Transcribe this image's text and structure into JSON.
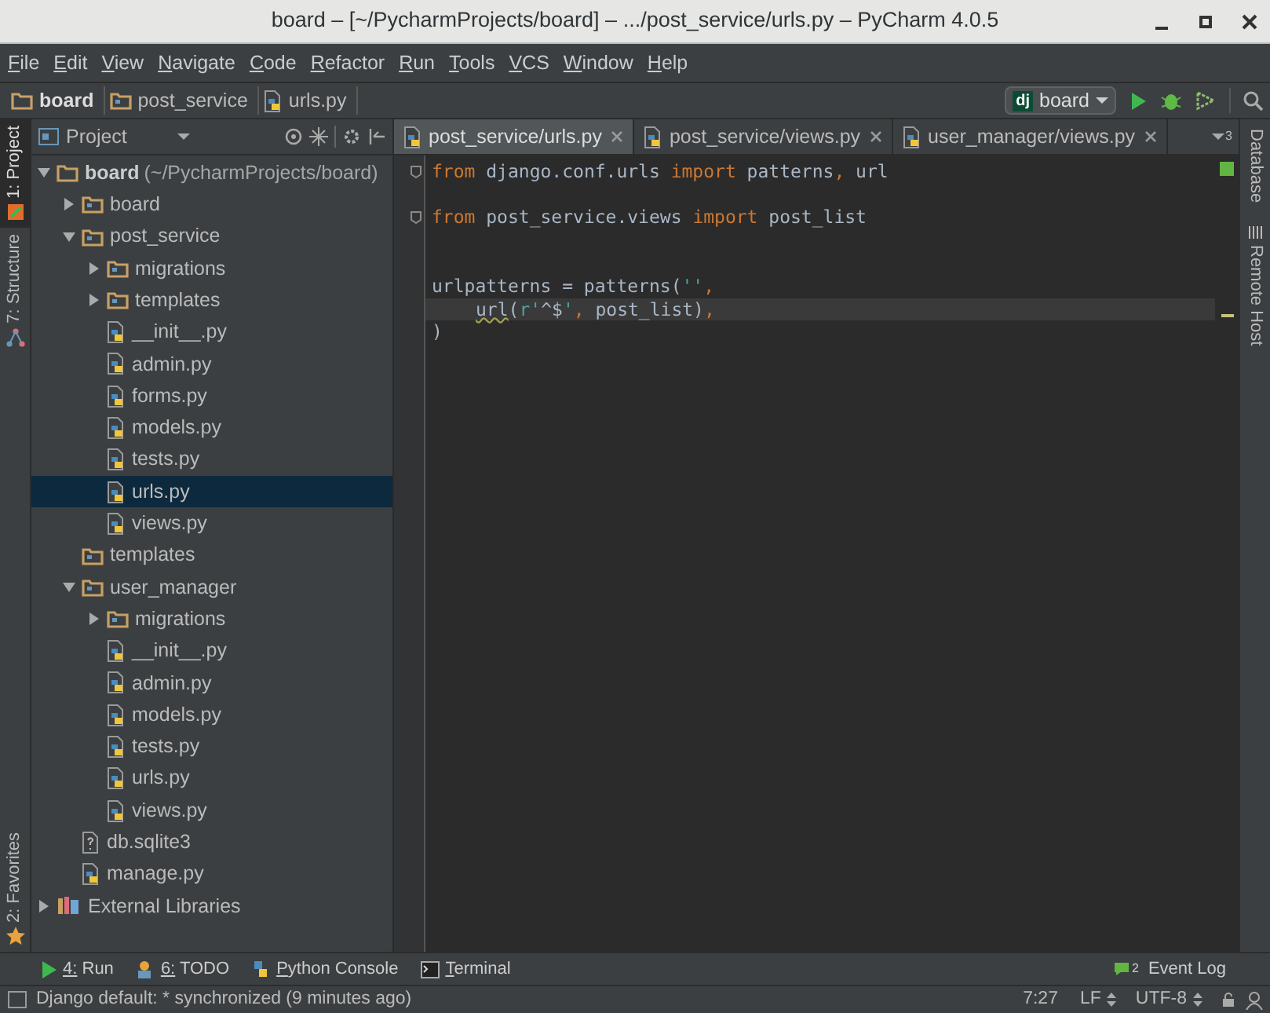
{
  "window": {
    "title": "board – [~/PycharmProjects/board] – .../post_service/urls.py – PyCharm 4.0.5"
  },
  "menu": [
    "File",
    "Edit",
    "View",
    "Navigate",
    "Code",
    "Refactor",
    "Run",
    "Tools",
    "VCS",
    "Window",
    "Help"
  ],
  "breadcrumbs": [
    {
      "label": "board",
      "kind": "folder"
    },
    {
      "label": "post_service",
      "kind": "module"
    },
    {
      "label": "urls.py",
      "kind": "python"
    }
  ],
  "run_config": {
    "badge": "dj",
    "label": "board"
  },
  "left_tools": [
    {
      "label": "1: Project",
      "selected": true,
      "kind": "project"
    },
    {
      "label": "7: Structure",
      "selected": false,
      "kind": "structure"
    },
    {
      "label": "2: Favorites",
      "selected": false,
      "kind": "favorites"
    }
  ],
  "right_tools": [
    {
      "label": "Database",
      "kind": "database"
    },
    {
      "label": "Remote Host",
      "kind": "server"
    }
  ],
  "project_panel": {
    "title": "Project",
    "tree": [
      {
        "label": "board",
        "suffix": "(~/PycharmProjects/board)",
        "kind": "folder",
        "expanded": true,
        "selected": false,
        "children": [
          {
            "label": "board",
            "kind": "module",
            "expanded": false,
            "selected": false
          },
          {
            "label": "post_service",
            "kind": "module",
            "expanded": true,
            "selected": false,
            "children": [
              {
                "label": "migrations",
                "kind": "module",
                "expanded": false,
                "selected": false
              },
              {
                "label": "templates",
                "kind": "module",
                "expanded": false,
                "selected": false
              },
              {
                "label": "__init__.py",
                "kind": "python",
                "selected": false
              },
              {
                "label": "admin.py",
                "kind": "python",
                "selected": false
              },
              {
                "label": "forms.py",
                "kind": "python",
                "selected": false
              },
              {
                "label": "models.py",
                "kind": "python",
                "selected": false
              },
              {
                "label": "tests.py",
                "kind": "python",
                "selected": false
              },
              {
                "label": "urls.py",
                "kind": "python",
                "selected": true
              },
              {
                "label": "views.py",
                "kind": "python",
                "selected": false
              }
            ]
          },
          {
            "label": "templates",
            "kind": "module",
            "selected": false
          },
          {
            "label": "user_manager",
            "kind": "module",
            "expanded": true,
            "selected": false,
            "children": [
              {
                "label": "migrations",
                "kind": "module",
                "expanded": false,
                "selected": false
              },
              {
                "label": "__init__.py",
                "kind": "python",
                "selected": false
              },
              {
                "label": "admin.py",
                "kind": "python",
                "selected": false
              },
              {
                "label": "models.py",
                "kind": "python",
                "selected": false
              },
              {
                "label": "tests.py",
                "kind": "python",
                "selected": false
              },
              {
                "label": "urls.py",
                "kind": "python",
                "selected": false
              },
              {
                "label": "views.py",
                "kind": "python",
                "selected": false
              }
            ]
          },
          {
            "label": "db.sqlite3",
            "kind": "unknown",
            "selected": false
          },
          {
            "label": "manage.py",
            "kind": "python",
            "selected": false
          }
        ]
      },
      {
        "label": "External Libraries",
        "kind": "library",
        "expanded": false,
        "selected": false
      }
    ]
  },
  "tabs": [
    {
      "label": "post_service/urls.py",
      "selected": true
    },
    {
      "label": "post_service/views.py",
      "selected": false
    },
    {
      "label": "user_manager/views.py",
      "selected": false
    }
  ],
  "tab_overflow": "3",
  "editor": {
    "lines": [
      {
        "kind": "code",
        "fold": true,
        "current": false,
        "tokens": [
          {
            "kind": "kw",
            "text": "from"
          },
          {
            "kind": "plain",
            "text": " django.conf.urls "
          },
          {
            "kind": "kw",
            "text": "import"
          },
          {
            "kind": "plain",
            "text": " patterns"
          },
          {
            "kind": "kw",
            "text": ","
          },
          {
            "kind": "plain",
            "text": " url"
          }
        ]
      },
      {
        "kind": "blank",
        "fold": false,
        "current": false
      },
      {
        "kind": "code",
        "fold": true,
        "current": false,
        "tokens": [
          {
            "kind": "kw",
            "text": "from"
          },
          {
            "kind": "plain",
            "text": " post_service.views "
          },
          {
            "kind": "kw",
            "text": "import"
          },
          {
            "kind": "plain",
            "text": " post_list"
          }
        ]
      },
      {
        "kind": "blank",
        "fold": false,
        "current": false
      },
      {
        "kind": "blank",
        "fold": false,
        "current": false
      },
      {
        "kind": "code",
        "fold": false,
        "current": false,
        "tokens": [
          {
            "kind": "plain",
            "text": "urlpatterns = patterns("
          },
          {
            "kind": "str",
            "text": "''"
          },
          {
            "kind": "kw",
            "text": ","
          }
        ]
      },
      {
        "kind": "indented",
        "fold": false,
        "current": true,
        "tokens": [
          {
            "kind": "warn",
            "text": "url"
          },
          {
            "kind": "plain",
            "text": "("
          },
          {
            "kind": "str",
            "text": "r'"
          },
          {
            "kind": "plain",
            "text": "^$"
          },
          {
            "kind": "str",
            "text": "'"
          },
          {
            "kind": "kw",
            "text": ","
          },
          {
            "kind": "plain",
            "text": " post_list)"
          },
          {
            "kind": "kw",
            "text": ","
          }
        ]
      },
      {
        "kind": "code",
        "fold": false,
        "current": false,
        "tokens": [
          {
            "kind": "plain",
            "text": ")"
          }
        ]
      }
    ]
  },
  "bottom_tools": [
    {
      "label": "4: Run",
      "kind": "run"
    },
    {
      "label": "6: TODO",
      "kind": "todo"
    },
    {
      "label": "Python Console",
      "kind": "python"
    },
    {
      "label": "Terminal",
      "kind": "terminal"
    }
  ],
  "event_log": {
    "label": "Event Log",
    "count": "2"
  },
  "status": {
    "message": "Django default: * synchronized (9 minutes ago)",
    "position": "7:27",
    "line_ending": "LF",
    "encoding": "UTF-8"
  }
}
